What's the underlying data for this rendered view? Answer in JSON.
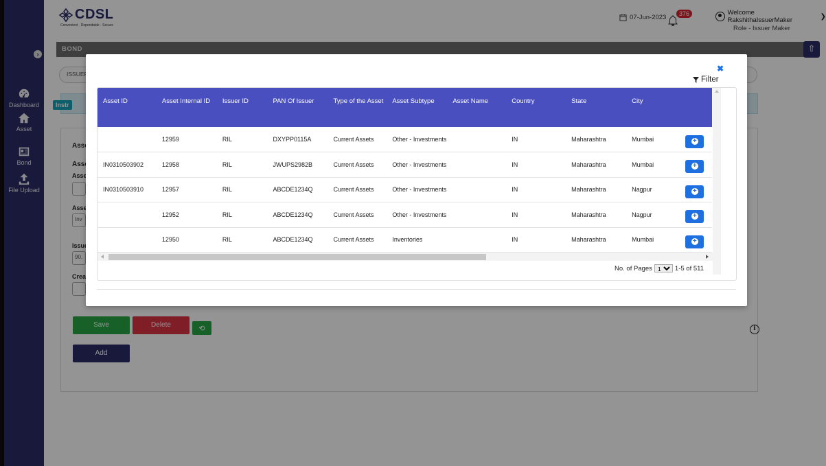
{
  "brand": {
    "name": "CDSL",
    "tagline": "Convenient · Dependable · Secure"
  },
  "header": {
    "date": "07-Jun-2023",
    "notification_count": "376",
    "welcome": "Welcome RakshithaIssuerMaker",
    "role": "Role - Issuer Maker"
  },
  "sidebar": {
    "items": [
      {
        "label": "Dashboard",
        "icon": "dashboard-icon"
      },
      {
        "label": "Asset",
        "icon": "home-icon"
      },
      {
        "label": "Bond",
        "icon": "id-card-icon"
      },
      {
        "label": "File Upload",
        "icon": "upload-icon"
      }
    ]
  },
  "page": {
    "section_title": "BOND",
    "issuer_pill": "ISSUER",
    "instruction_tag": "Instr",
    "labels": {
      "l1": "Asse",
      "l2": "Asse",
      "l3": "Asse",
      "l4": "Asse",
      "l5": "Issue",
      "l6": "Creat"
    },
    "inputs": {
      "asset_type": "Inv",
      "issue": "90."
    },
    "buttons": {
      "save": "Save",
      "delete": "Delete",
      "add": "Add"
    }
  },
  "modal": {
    "filter_label": "Filter",
    "columns": [
      "Asset ID",
      "Asset Internal ID",
      "Issuer ID",
      "PAN Of Issuer",
      "Type of the Asset",
      "Asset Subtype",
      "Asset Name",
      "Country",
      "State",
      "City"
    ],
    "rows": [
      [
        "",
        "12959",
        "RIL",
        "DXYPP0115A",
        "Current Assets",
        "Other - Investments",
        "",
        "IN",
        "Maharashtra",
        "Mumbai"
      ],
      [
        "IN0310503902",
        "12958",
        "RIL",
        "JWUPS2982B",
        "Current Assets",
        "Other - Investments",
        "",
        "IN",
        "Maharashtra",
        "Mumbai"
      ],
      [
        "IN0310503910",
        "12957",
        "RIL",
        "ABCDE1234Q",
        "Current Assets",
        "Other - Investments",
        "",
        "IN",
        "Maharashtra",
        "Nagpur"
      ],
      [
        "",
        "12952",
        "RIL",
        "ABCDE1234Q",
        "Current Assets",
        "Other - Investments",
        "",
        "IN",
        "Maharashtra",
        "Nagpur"
      ],
      [
        "",
        "12950",
        "RIL",
        "ABCDE1234Q",
        "Current Assets",
        "Inventories",
        "",
        "IN",
        "Maharashtra",
        "Mumbai"
      ]
    ],
    "pager": {
      "label": "No. of Pages",
      "page": "1",
      "range": "1-5 of 511"
    }
  },
  "colors": {
    "sidebar": "#2b2e66",
    "table_header": "#4a4fc0",
    "row_button": "#1e6fe0",
    "save": "#28a745",
    "delete": "#dc3545"
  }
}
